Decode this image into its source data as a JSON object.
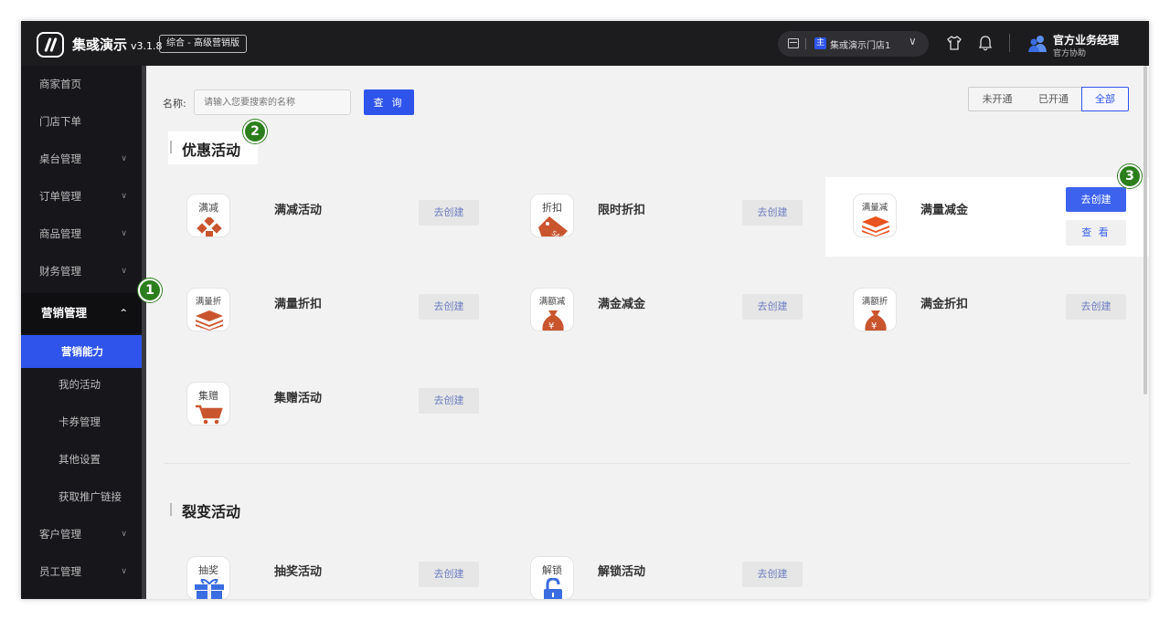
{
  "header": {
    "app_name": "集彧演示",
    "version": "v3.1.8",
    "plan": "综合 - 高级营销版",
    "store_badge": "主",
    "store_name": "集彧演示门店1",
    "user_name": "官方业务经理",
    "user_role": "官方协助"
  },
  "sidebar": {
    "items": [
      {
        "label": "商家首页"
      },
      {
        "label": "门店下单"
      },
      {
        "label": "桌台管理"
      },
      {
        "label": "订单管理"
      },
      {
        "label": "商品管理"
      },
      {
        "label": "财务管理"
      },
      {
        "label": "营销管理"
      },
      {
        "label": "营销能力"
      },
      {
        "label": "我的活动"
      },
      {
        "label": "卡券管理"
      },
      {
        "label": "其他设置"
      },
      {
        "label": "获取推广链接"
      },
      {
        "label": "客户管理"
      },
      {
        "label": "员工管理"
      }
    ]
  },
  "search": {
    "label": "名称:",
    "placeholder": "请输入您要搜索的名称",
    "button": "查 询"
  },
  "filters": [
    "未开通",
    "已开通",
    "全部"
  ],
  "sections": [
    {
      "title": "优惠活动",
      "cards": [
        {
          "icon_text": "满减",
          "name": "满减活动",
          "button": "去创建"
        },
        {
          "icon_text": "折扣",
          "name": "限时折扣",
          "button": "去创建"
        },
        {
          "icon_text": "满量减",
          "name": "满量减金",
          "button": "去创建",
          "view_button": "查 看"
        },
        {
          "icon_text": "满量折",
          "name": "满量折扣",
          "button": "去创建"
        },
        {
          "icon_text": "满额减",
          "name": "满金减金",
          "button": "去创建"
        },
        {
          "icon_text": "满额折",
          "name": "满金折扣",
          "button": "去创建"
        },
        {
          "icon_text": "集赠",
          "name": "集赠活动",
          "button": "去创建"
        }
      ]
    },
    {
      "title": "裂变活动",
      "cards": [
        {
          "icon_text": "抽奖",
          "name": "抽奖活动",
          "button": "去创建"
        },
        {
          "icon_text": "解锁",
          "name": "解锁活动",
          "button": "去创建"
        }
      ]
    }
  ],
  "steps": [
    "1",
    "2",
    "3"
  ],
  "colors": {
    "accent": "#2f54eb",
    "step_green": "#2c7e1d",
    "icon_orange": "#e8531f",
    "icon_blue": "#3a6de0",
    "topbar": "#1c1c1e",
    "sidebar": "#17171b"
  }
}
